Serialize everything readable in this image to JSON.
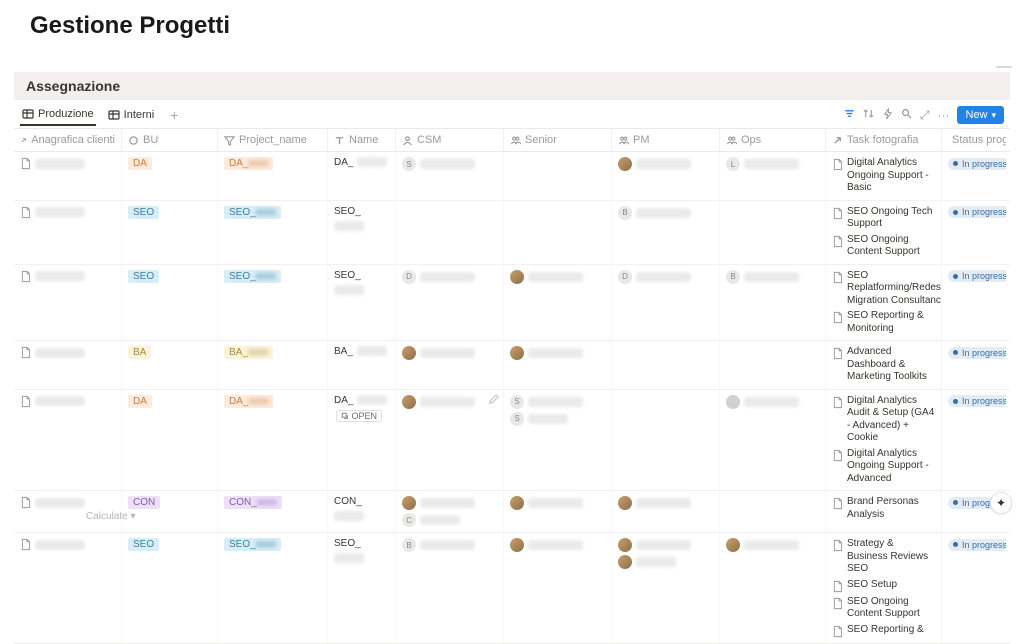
{
  "page": {
    "title": "Gestione Progetti"
  },
  "section": {
    "title": "Assegnazione"
  },
  "tabs": {
    "items": [
      {
        "label": "Produzione",
        "active": true
      },
      {
        "label": "Interni",
        "active": false
      }
    ]
  },
  "toolbar": {
    "new_label": "New"
  },
  "columns": {
    "anagrafica": "Anagrafica clienti",
    "bu": "BU",
    "project_name": "Project_name",
    "name": "Name",
    "csm": "CSM",
    "senior": "Senior",
    "pm": "PM",
    "ops": "Ops",
    "task": "Task fotografia",
    "status": "Status progetti"
  },
  "status_label": "In progress",
  "open_label": "OPEN",
  "calculate_label": "Calculate",
  "rows": [
    {
      "bu": "DA",
      "proj_prefix": "DA_",
      "name_prefix": "DA_",
      "csm_letter": "S",
      "pm_avatar": true,
      "ops_letter": "L",
      "tasks": [
        "Digital Analytics Ongoing Support - Basic"
      ]
    },
    {
      "bu": "SEO",
      "proj_prefix": "SEO_",
      "name_prefix": "SEO_",
      "pm_letter": "B",
      "tasks": [
        "SEO Ongoing Tech Support",
        "SEO Ongoing Content Support"
      ]
    },
    {
      "bu": "SEO",
      "proj_prefix": "SEO_",
      "name_prefix": "SEO_",
      "csm_letter": "D",
      "senior_avatar": true,
      "pm_letter": "D",
      "ops_letter": "B",
      "tasks": [
        "SEO Replatforming/Redesign Migration Consultancy",
        "SEO Reporting & Monitoring"
      ]
    },
    {
      "bu": "BA",
      "proj_prefix": "BA_",
      "name_prefix": "BA_",
      "csm_avatar": true,
      "senior_avatar": true,
      "tasks": [
        "Advanced Dashboard & Marketing Toolkits"
      ]
    },
    {
      "bu": "DA",
      "proj_prefix": "DA_",
      "name_prefix": "DA_",
      "hovered": true,
      "csm_avatar": true,
      "senior_letter": "S",
      "senior_two": true,
      "ops_avatar": true,
      "ops_gray": true,
      "tasks": [
        "Digital Analytics Audit & Setup (GA4 - Advanced) + Cookie",
        "Digital Analytics Ongoing Support - Advanced"
      ]
    },
    {
      "bu": "CON",
      "proj_prefix": "CON_",
      "name_prefix": "CON_",
      "csm_avatar": true,
      "csm_two_letter": "C",
      "senior_avatar": true,
      "pm_avatar": true,
      "tasks": [
        "Brand Personas Analysis"
      ]
    },
    {
      "bu": "SEO",
      "proj_prefix": "SEO_",
      "name_prefix": "SEO_",
      "csm_letter": "B",
      "senior_avatar": true,
      "pm_avatar": true,
      "pm_two": true,
      "ops_avatar": true,
      "tasks": [
        "Strategy & Business Reviews SEO",
        "SEO Setup",
        "SEO Ongoing Content Support",
        "SEO Reporting &"
      ]
    }
  ]
}
